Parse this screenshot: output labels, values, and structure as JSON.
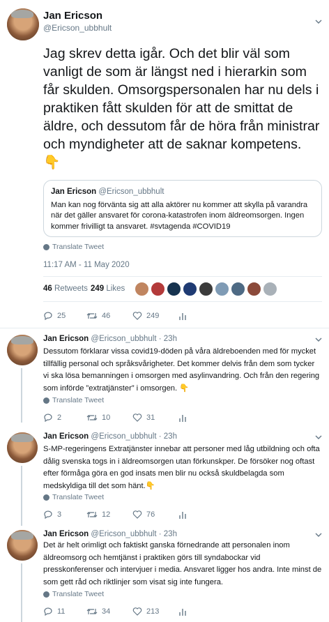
{
  "main_tweet": {
    "author_name": "Jan Ericson",
    "author_handle": "@Ericson_ubbhult",
    "text": "Jag skrev detta igår. Och det blir väl som vanligt de som är längst ned i hierarkin som får skulden. Omsorgspersonalen har nu dels i praktiken fått skulden för att de smittat de äldre, och dessutom får de höra från ministrar och myndigheter att de saknar kompetens. 👇",
    "quoted": {
      "author_name": "Jan Ericson",
      "author_handle": "@Ericson_ubbhult",
      "text": "Man kan nog förvänta sig att alla aktörer nu kommer att skylla på varandra när det gäller ansvaret för corona-katastrofen inom äldreomsorgen. Ingen kommer frivilligt ta ansvaret. #svtagenda #COVID19"
    },
    "translate_label": "Translate Tweet",
    "timestamp": "11:17 AM - 11 May 2020",
    "retweets_count": "46",
    "retweets_label": "Retweets",
    "likes_count": "249",
    "likes_label": "Likes",
    "actions": {
      "replies": "25",
      "retweets": "46",
      "likes": "249"
    }
  },
  "replies": [
    {
      "author_name": "Jan Ericson",
      "author_handle": "@Ericson_ubbhult",
      "time": "· 23h",
      "text": "Dessutom förklarar vissa covid19-döden på våra äldreboenden med för mycket tillfällig personal och språksvårigheter. Det kommer delvis från dem som tycker vi ska lösa bemanningen i omsorgen med asylinvandring. Och från den regering som införde ”extratjänster” i omsorgen. 👇",
      "translate_label": "Translate Tweet",
      "actions": {
        "replies": "2",
        "retweets": "10",
        "likes": "31"
      }
    },
    {
      "author_name": "Jan Ericson",
      "author_handle": "@Ericson_ubbhult",
      "time": "· 23h",
      "text": "S-MP-regeringens Extratjänster innebar att personer med låg utbildning och ofta dålig svenska togs in i äldreomsorgen utan förkunskper. De försöker nog oftast efter förmåga göra en god insats men blir nu också skuldbelagda som medskyldiga till det som hänt.👇",
      "translate_label": "Translate Tweet",
      "actions": {
        "replies": "3",
        "retweets": "12",
        "likes": "76"
      }
    },
    {
      "author_name": "Jan Ericson",
      "author_handle": "@Ericson_ubbhult",
      "time": "· 23h",
      "text": "Det är helt orimligt och faktiskt ganska förnedrande att personalen inom äldreomsorg och hemtjänst i praktiken görs till syndabockar vid presskonferenser och intervjuer i media. Ansvaret ligger hos andra. Inte minst de som gett råd och riktlinjer som visat sig inte fungera.",
      "translate_label": "Translate Tweet",
      "actions": {
        "replies": "11",
        "retweets": "34",
        "likes": "213"
      }
    }
  ],
  "colors": {
    "muted": "#657786",
    "border": "#e6ecf0",
    "text": "#14171a",
    "link": "#1da1f2"
  }
}
